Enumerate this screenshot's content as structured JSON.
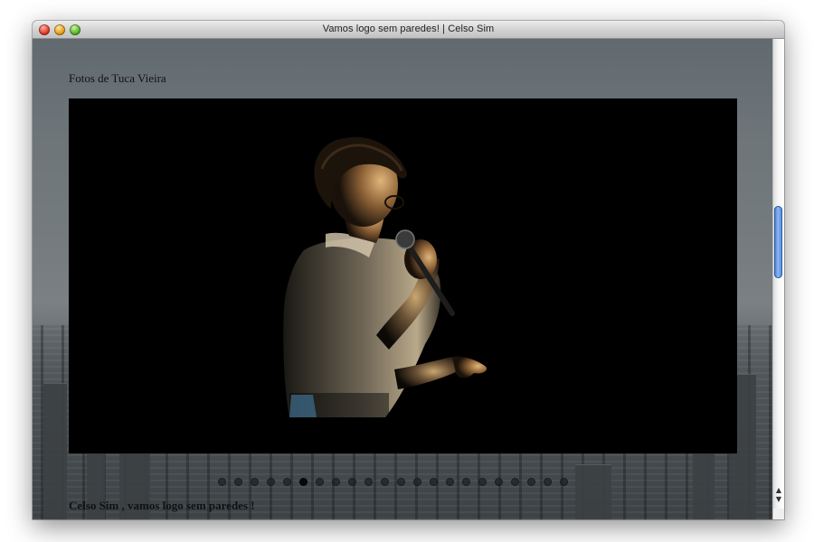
{
  "window": {
    "title": "Vamos logo sem paredes! | Celso Sim"
  },
  "page": {
    "photo_credit": "Fotos de Tuca Vieira",
    "caption": "Celso Sim , vamos logo sem paredes !",
    "slideshow": {
      "total_slides": 22,
      "active_index": 5
    }
  },
  "icons": {
    "close": "close-icon",
    "minimize": "minimize-icon",
    "zoom": "zoom-icon",
    "scroll_up": "chevron-up-icon",
    "scroll_down": "chevron-down-icon"
  },
  "colors": {
    "photo_background": "#000000",
    "scroll_thumb": "#5b8fe0"
  }
}
